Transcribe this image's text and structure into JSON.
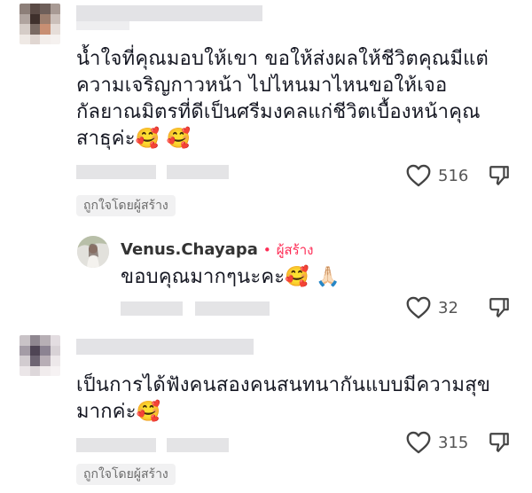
{
  "comments": [
    {
      "text_lines": [
        "น้ำใจที่คุณมอบให้เขา ขอให้ส่งผลให้ชีวิตคุณมีแต่",
        "ความเจริญกาวหน้า ไปไหนมาไหนขอให้เจอ",
        "กัลยาณมิตรที่ดีเป็นศรีมงคลแก่ชีวิตเบื้องหน้าคุณ",
        "สาธุค่ะ🥰 🥰"
      ],
      "likes": "516",
      "creator_liked_badge": "ถูกใจโดยผู้สร้าง"
    },
    {
      "author": "Venus.Chayapa",
      "creator_dot": "•",
      "creator_label": "ผู้สร้าง",
      "text_lines": [
        "ขอบคุณมากๆนะคะ🥰 🙏🏻"
      ],
      "likes": "32"
    },
    {
      "text_lines": [
        "เป็นการได้ฟังคนสองคนสนทนากันแบบมีความสุข",
        "มากค่ะ🥰"
      ],
      "likes": "315",
      "creator_liked_badge": "ถูกใจโดยผู้สร้าง"
    }
  ],
  "icons": {
    "like": "heart-outline-icon",
    "dislike": "thumbs-down-outline-icon"
  },
  "colors": {
    "creator": "#fe2c55",
    "text": "#161823",
    "muted": "#555555"
  }
}
